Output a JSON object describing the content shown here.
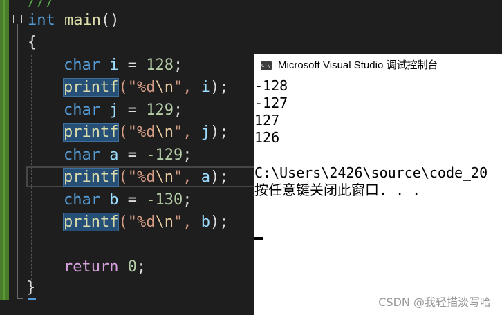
{
  "editor": {
    "top_fragment": "///",
    "signature": {
      "type": "int",
      "name": "main",
      "parens": "()"
    },
    "open_brace": "{",
    "close_brace": "}",
    "lines": [
      {
        "type": "char",
        "var": "i",
        "op": " = ",
        "value": "128",
        "end": ";"
      },
      {
        "func": "printf",
        "fmt_open": "(\"",
        "fmt": "%d",
        "esc": "\\n",
        "fmt_close": "\", ",
        "arg": "i",
        "end": ");"
      },
      {
        "type": "char",
        "var": "j",
        "op": " = ",
        "value": "129",
        "end": ";"
      },
      {
        "func": "printf",
        "fmt_open": "(\"",
        "fmt": "%d",
        "esc": "\\n",
        "fmt_close": "\", ",
        "arg": "j",
        "end": ");"
      },
      {
        "type": "char",
        "var": "a",
        "op": " = ",
        "value": "-129",
        "end": ";"
      },
      {
        "func": "printf",
        "fmt_open": "(\"",
        "fmt": "%d",
        "esc": "\\n",
        "fmt_close": "\", ",
        "arg": "a",
        "end": ");"
      },
      {
        "type": "char",
        "var": "b",
        "op": " = ",
        "value": "-130",
        "end": ";"
      },
      {
        "func": "printf",
        "fmt_open": "(\"",
        "fmt": "%d",
        "esc": "\\n",
        "fmt_close": "\", ",
        "arg": "b",
        "end": ");"
      }
    ],
    "return_kw": "return",
    "return_value": "0",
    "return_end": ";"
  },
  "console": {
    "title": "Microsoft Visual Studio 调试控制台",
    "output": [
      "-128",
      "-127",
      "127",
      "126"
    ],
    "path": "C:\\Users\\2426\\source\\code_20",
    "press_key": "按任意键关闭此窗口. . ."
  },
  "watermark": "CSDN @我轻描淡写哈",
  "colors": {
    "keyword": "#569cd6",
    "function": "#dcdcaa",
    "number": "#b5cea8",
    "string": "#d69d85",
    "variable": "#9cdcfe",
    "control": "#d8a0df",
    "selection": "#264f78"
  }
}
